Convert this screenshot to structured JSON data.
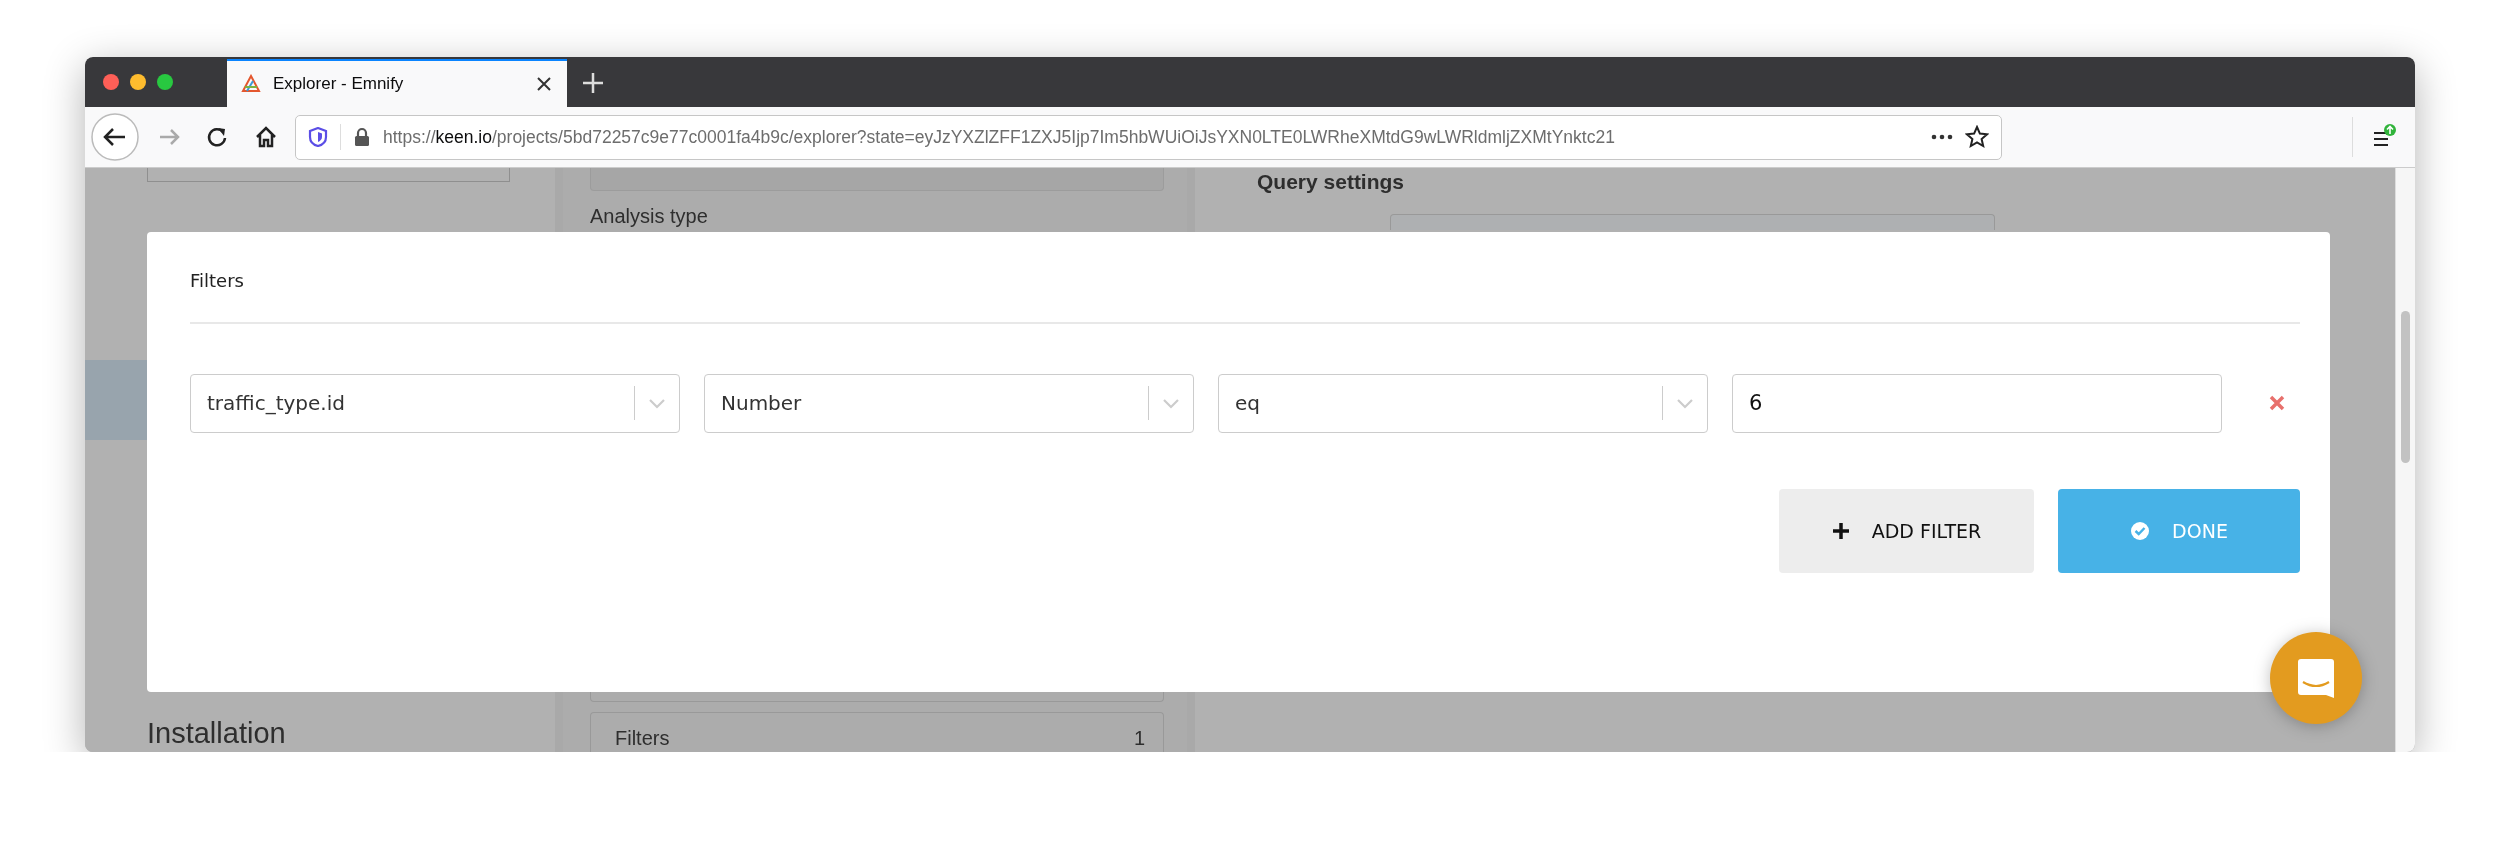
{
  "browser": {
    "tab": {
      "title": "Explorer - Emnify",
      "selected": true
    },
    "url_parts": [
      "https://",
      "keen.io",
      "/projects/5bd72257c9e77c0001fa4b9c/explorer?state=eyJzYXZlZFF1ZXJ5Ijp7Im5hbWUiOiJsYXN0LTE0LWRheXMtdG9wLWRldmljZXMtYnktc21"
    ]
  },
  "background": {
    "sidebar": {
      "heading": "Installation"
    },
    "query": {
      "analysis_label": "Analysis type",
      "filters_label": "Filters",
      "filters_count": "1"
    },
    "settings": {
      "title": "Query settings"
    }
  },
  "modal": {
    "title": "Filters",
    "filters": [
      {
        "property": "traffic_type.id",
        "type": "Number",
        "operator": "eq",
        "value": "6"
      }
    ],
    "buttons": [
      {
        "label": "ADD FILTER",
        "kind": "secondary"
      },
      {
        "label": "DONE",
        "kind": "primary"
      }
    ]
  }
}
